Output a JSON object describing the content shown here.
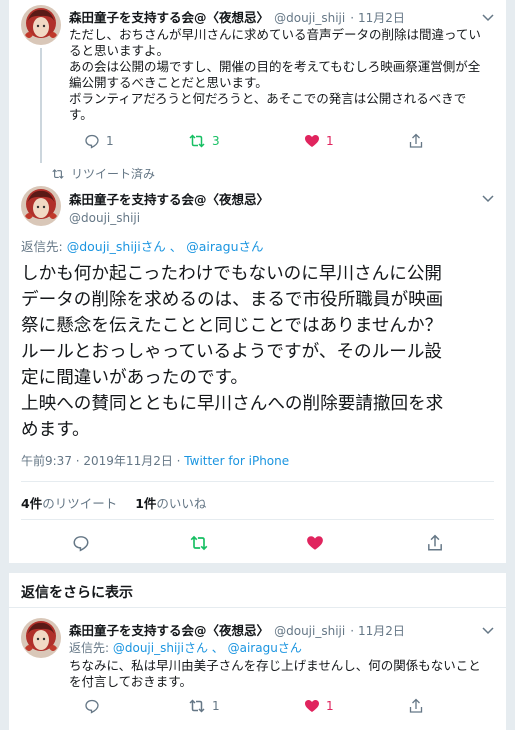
{
  "tweet1": {
    "display_name": "森田童子を支持する会@〈夜想忌〉",
    "handle": "@douji_shiji",
    "date": "11月2日",
    "lines": [
      "ただし、おちさんが早川さんに求めている音声データの削除は間違ってい",
      "ると思いますよ。",
      "あの会は公開の場ですし、開催の目的を考えてもむしろ映画祭運営側が全",
      "編公開するべきことだと思います。",
      "ボランティアだろうと何だろうと、あそこでの発言は公開されるべきで",
      "す。"
    ],
    "reply_count": "1",
    "retweet_count": "3",
    "like_count": "1"
  },
  "retweeted_label": "リツイート済み",
  "main_tweet": {
    "display_name": "森田童子を支持する会@〈夜想忌〉",
    "handle": "@douji_shiji",
    "reply_to_prefix": "返信先: ",
    "reply_to_user1": "@douji_shiji",
    "reply_to_san1": "さん 、",
    "reply_to_user2": "@airagu",
    "reply_to_san2": "さん",
    "lines": [
      "しかも何か起こったわけでもないのに早川さんに公開",
      "データの削除を求めるのは、まるで市役所職員が映画",
      "祭に懸念を伝えたことと同じことではありませんか？",
      "ルールとおっしゃっているようですが、そのルール設",
      "定に間違いがあったのです。",
      "上映への賛同とともに早川さんへの削除要請撤回を求",
      "めます。"
    ],
    "timestamp": "午前9:37 · 2019年11月2日 · ",
    "source": "Twitter for iPhone",
    "retweets_num": "4件",
    "retweets_label": "のリツイート",
    "likes_num": "1件",
    "likes_label": "のいいね"
  },
  "more_replies_label": "返信をさらに表示",
  "tweet3": {
    "display_name": "森田童子を支持する会@〈夜想忌〉",
    "handle": "@douji_shiji",
    "date": "11月2日",
    "reply_to_prefix": "返信先: ",
    "reply_to_user1": "@douji_shiji",
    "reply_to_san1": "さん 、",
    "reply_to_user2": "@airagu",
    "reply_to_san2": "さん",
    "lines": [
      "ちなみに、私は早川由美子さんを存じ上げませんし、何の関係もないこと",
      "を付言しておきます。"
    ],
    "reply_count": "",
    "retweet_count": "1",
    "like_count": "1"
  },
  "colors": {
    "accent": "#1da1f2",
    "link": "#1b95e0",
    "retweet": "#17bf63",
    "like": "#e0245e",
    "muted": "#657786"
  },
  "icons": [
    "chevron-down-icon",
    "reply-icon",
    "retweet-icon",
    "heart-icon",
    "share-icon",
    "avatar"
  ]
}
